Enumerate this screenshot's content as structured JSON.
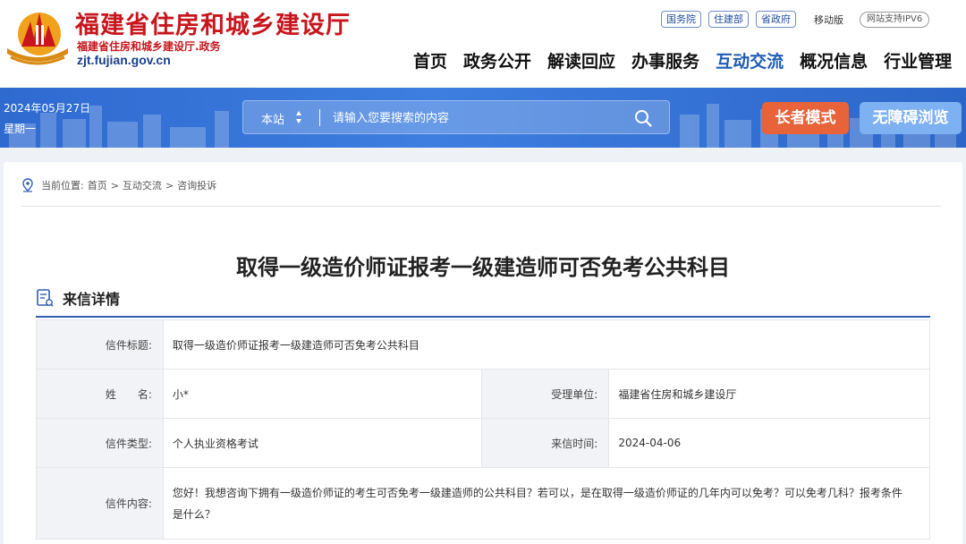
{
  "header": {
    "site_name": "福建省住房和城乡建设厅",
    "site_sub": "福建省住房和城乡建设厅.政务",
    "site_domain": "zjt.fujian.gov.cn",
    "top_links": [
      "国务院",
      "住建部",
      "省政府"
    ],
    "mobile_label": "移动版",
    "ipv6_label": "网站支持IPV6",
    "nav": [
      "首页",
      "政务公开",
      "解读回应",
      "办事服务",
      "互动交流",
      "概况信息",
      "行业管理"
    ],
    "active_nav": "互动交流"
  },
  "banner": {
    "date": "2024年05月27日",
    "weekday": "星期一",
    "search_scope": "本站",
    "search_placeholder": "请输入您要搜索的内容",
    "elder_mode": "长者模式",
    "accessible": "无障碍浏览"
  },
  "breadcrumb": {
    "prefix": "当前位置:",
    "items": [
      "首页",
      "互动交流",
      "咨询投诉"
    ],
    "separator": ">"
  },
  "article": {
    "title": "取得一级造价师证报考一级建造师可否免考公共科目",
    "section_title": "来信详情",
    "rows": {
      "subject_label": "信件标题:",
      "subject_value": "取得一级造价师证报考一级建造师可否免考公共科目",
      "name_label": "姓　　名:",
      "name_value": "小*",
      "unit_label": "受理单位:",
      "unit_value": "福建省住房和城乡建设厅",
      "type_label": "信件类型:",
      "type_value": "个人执业资格考试",
      "time_label": "来信时间:",
      "time_value": "2024-04-06",
      "content_label": "信件内容:",
      "content_value": "您好！我想咨询下拥有一级造价师证的考生可否免考一级建造师的公共科目？若可以，是在取得一级造价师证的几年内可以免考？可以免考几科？报考条件是什么？"
    }
  },
  "colors": {
    "brand_red": "#c8161d",
    "nav_blue": "#1f5db5",
    "banner_blue": "#3d7ee0",
    "elder_orange": "#e8623a",
    "accessible_blue": "#7db1f2"
  }
}
